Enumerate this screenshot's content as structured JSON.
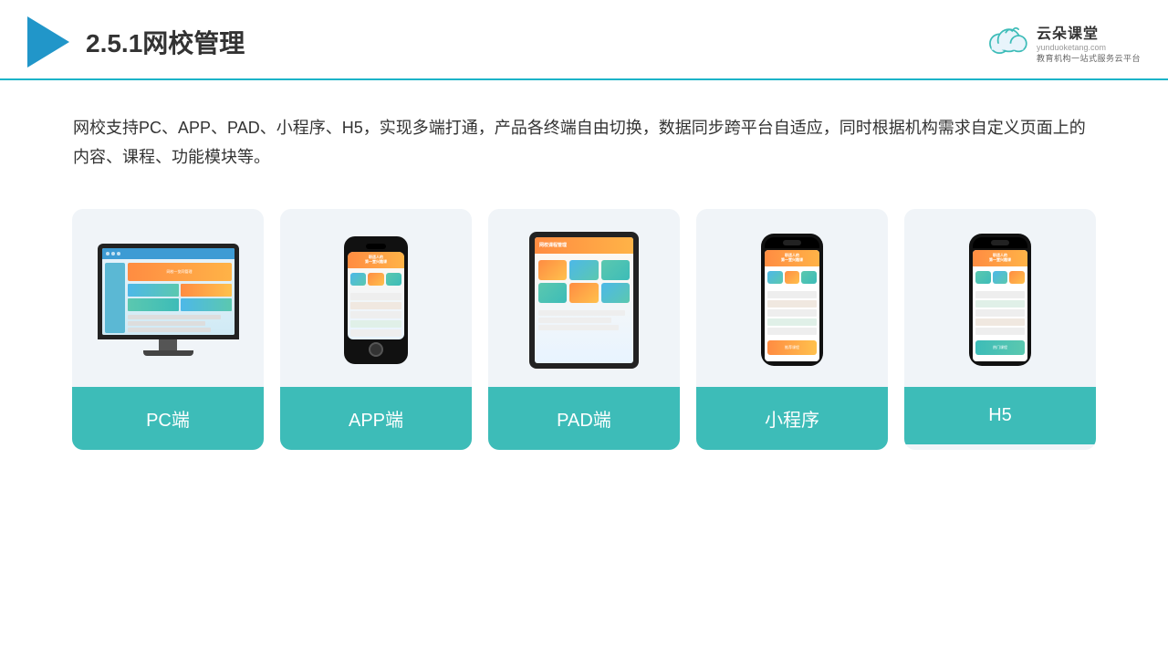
{
  "header": {
    "title": "2.5.1网校管理",
    "brand": {
      "name": "云朵课堂",
      "url": "yunduoketang.com",
      "sub": "教育机构一站式服务云平台"
    }
  },
  "description": {
    "text": "网校支持PC、APP、PAD、小程序、H5，实现多端打通，产品各终端自由切换，数据同步跨平台自适应，同时根据机构需求自定义页面上的内容、课程、功能模块等。"
  },
  "cards": [
    {
      "id": "pc",
      "label": "PC端"
    },
    {
      "id": "app",
      "label": "APP端"
    },
    {
      "id": "pad",
      "label": "PAD端"
    },
    {
      "id": "miniprogram",
      "label": "小程序"
    },
    {
      "id": "h5",
      "label": "H5"
    }
  ],
  "colors": {
    "accent": "#3dbcb8",
    "header_line": "#1ab3c8",
    "title_color": "#333333",
    "card_bg": "#f0f4f8"
  }
}
